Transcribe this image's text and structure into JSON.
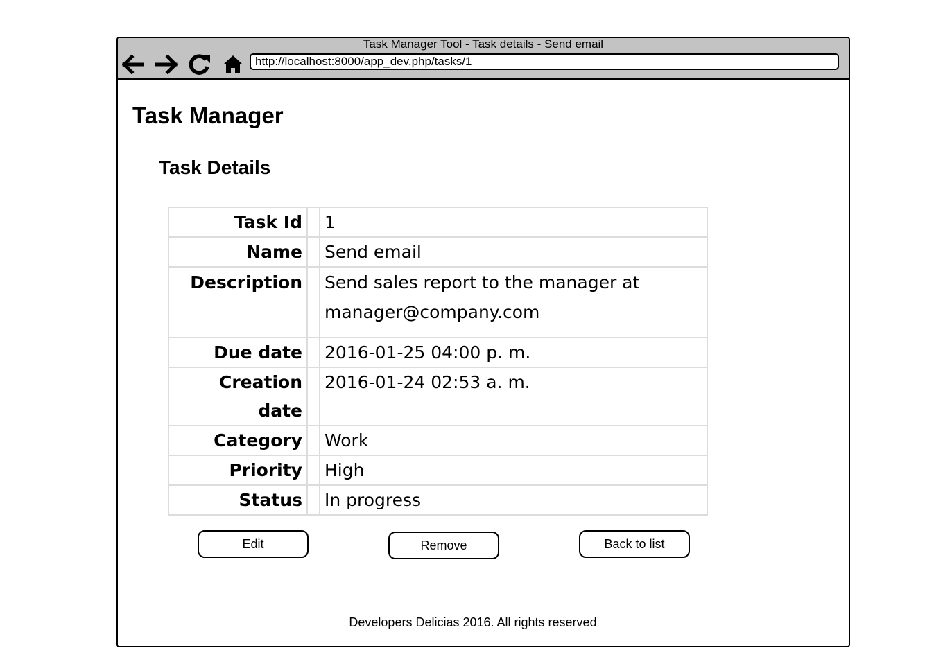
{
  "browser": {
    "window_title": "Task Manager Tool - Task details - Send email",
    "url": "http://localhost:8000/app_dev.php/tasks/1",
    "nav_icons": [
      "arrow-left-icon",
      "arrow-right-icon",
      "reload-icon",
      "home-icon"
    ]
  },
  "page": {
    "title": "Task Manager",
    "section_title": "Task Details"
  },
  "task": {
    "rows": [
      {
        "label": "Task Id",
        "value": "1"
      },
      {
        "label": "Name",
        "value": "Send email"
      },
      {
        "label": "Description",
        "value_line1": "Send sales report to the manager at",
        "value_line2": "manager@company.com"
      },
      {
        "label": "Due date",
        "value": "2016-01-25 04:00 p. m."
      },
      {
        "label": "Creation date",
        "value": "2016-01-24 02:53 a. m."
      },
      {
        "label": "Category",
        "value": "Work"
      },
      {
        "label": "Priority",
        "value": "High"
      },
      {
        "label": "Status",
        "value": "In progress"
      }
    ]
  },
  "actions": {
    "edit_label": "Edit",
    "remove_label": "Remove",
    "back_label": "Back to list"
  },
  "footer": {
    "text": "Developers Delicias 2016. All rights reserved"
  }
}
